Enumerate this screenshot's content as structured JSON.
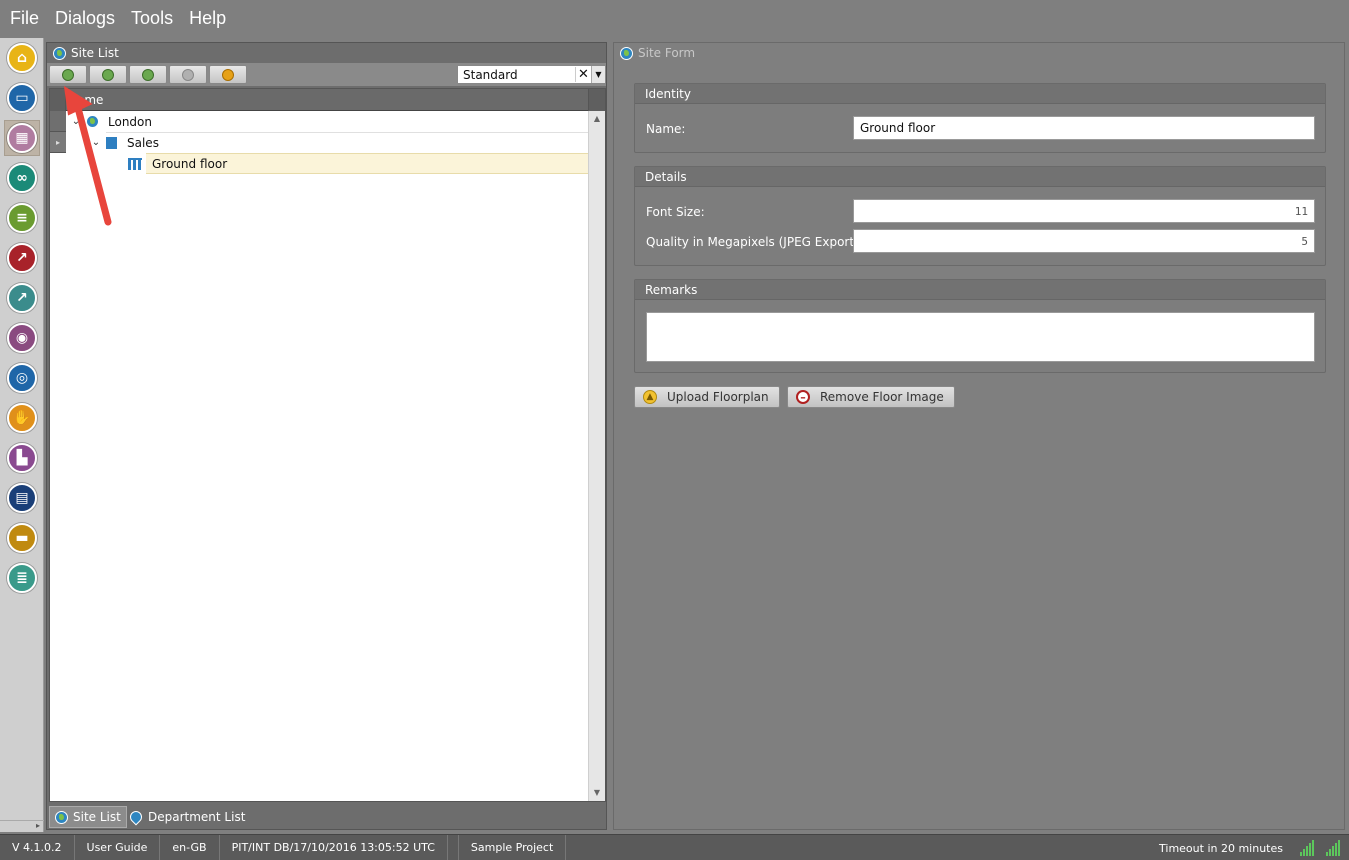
{
  "menu": [
    "File",
    "Dialogs",
    "Tools",
    "Help"
  ],
  "rail": {
    "icons": [
      {
        "name": "home-icon",
        "color": "#e8b416",
        "glyph": "⌂"
      },
      {
        "name": "folder-icon",
        "color": "#1f66a8",
        "glyph": "▭"
      },
      {
        "name": "org-chart-icon",
        "color": "#b07ca0",
        "glyph": "▦"
      },
      {
        "name": "binoculars-icon",
        "color": "#1b8a78",
        "glyph": "∞"
      },
      {
        "name": "scroll-icon",
        "color": "#6a9b30",
        "glyph": "≡"
      },
      {
        "name": "chart-icon",
        "color": "#a8222a",
        "glyph": "↗"
      },
      {
        "name": "trend-icon",
        "color": "#3b8c8c",
        "glyph": "↗"
      },
      {
        "name": "eye-icon",
        "color": "#8a4a80",
        "glyph": "◉"
      },
      {
        "name": "target-icon",
        "color": "#1f66a8",
        "glyph": "◎"
      },
      {
        "name": "handshake-icon",
        "color": "#e0901a",
        "glyph": "✋"
      },
      {
        "name": "bar-chart-icon",
        "color": "#8a4a90",
        "glyph": "▙"
      },
      {
        "name": "document-icon",
        "color": "#1a3f78",
        "glyph": "▤"
      },
      {
        "name": "briefcase-icon",
        "color": "#c08a10",
        "glyph": "▬"
      },
      {
        "name": "database-icon",
        "color": "#3a9a8a",
        "glyph": "≣"
      }
    ]
  },
  "site_list": {
    "title": "Site List",
    "view": "Standard",
    "column": "Name",
    "tree": [
      {
        "label": "London",
        "level": 0,
        "expanded": true
      },
      {
        "label": "Sales",
        "level": 1,
        "expanded": true
      },
      {
        "label": "Ground floor",
        "level": 2,
        "selected": true
      }
    ],
    "tabs": [
      "Site List",
      "Department List"
    ]
  },
  "site_form": {
    "title": "Site Form",
    "identity": {
      "heading": "Identity",
      "name_label": "Name:",
      "name_value": "Ground floor"
    },
    "details": {
      "heading": "Details",
      "font_size_label": "Font Size:",
      "font_size_value": "11",
      "quality_label": "Quality in Megapixels (JPEG Export):",
      "quality_value": "5"
    },
    "remarks": {
      "heading": "Remarks",
      "value": ""
    },
    "buttons": {
      "upload": "Upload Floorplan",
      "remove": "Remove Floor Image"
    }
  },
  "status": {
    "version": "V 4.1.0.2",
    "guide": "User Guide",
    "locale": "en-GB",
    "db": "PIT/INT DB/17/10/2016 13:05:52 UTC",
    "project": "Sample Project",
    "timeout": "Timeout in 20 minutes"
  },
  "colors": {
    "accent": "#2e86c1",
    "selection": "#fbf4d9",
    "annotation": "#e8453c"
  }
}
